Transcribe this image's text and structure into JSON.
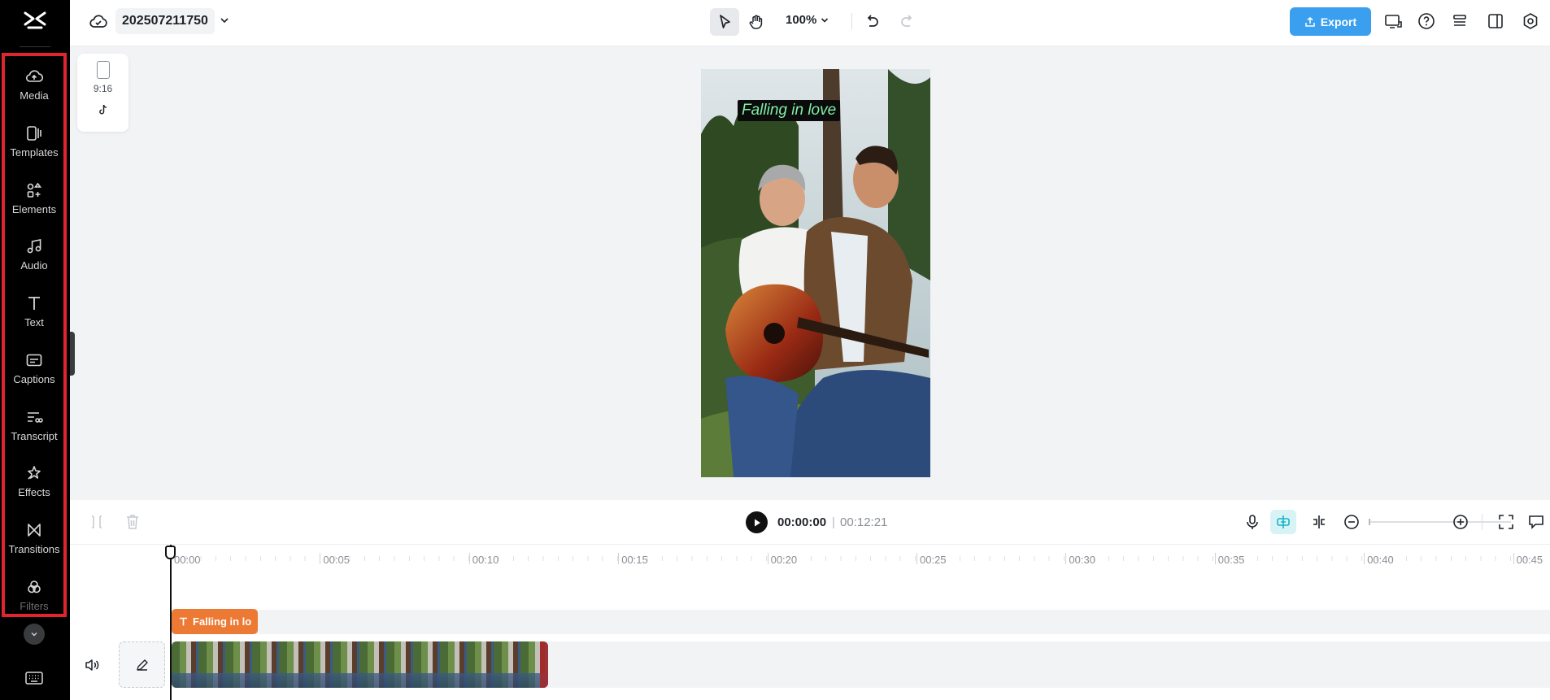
{
  "sidebar": {
    "items": [
      {
        "label": "Media",
        "icon": "media-cloud-icon"
      },
      {
        "label": "Templates",
        "icon": "templates-icon"
      },
      {
        "label": "Elements",
        "icon": "elements-icon"
      },
      {
        "label": "Audio",
        "icon": "audio-note-icon"
      },
      {
        "label": "Text",
        "icon": "text-t-icon"
      },
      {
        "label": "Captions",
        "icon": "captions-icon"
      },
      {
        "label": "Transcript",
        "icon": "transcript-icon"
      },
      {
        "label": "Effects",
        "icon": "effects-star-icon"
      },
      {
        "label": "Transitions",
        "icon": "transitions-icon"
      },
      {
        "label": "Filters",
        "icon": "filters-icon"
      }
    ]
  },
  "topbar": {
    "project_name": "202507211750",
    "zoom": "100%",
    "export_label": "Export"
  },
  "canvas": {
    "aspect_ratio": "9:16",
    "caption_text": "Falling in love"
  },
  "playback": {
    "current_time": "00:00:00",
    "separator": "|",
    "total_time": "00:12:21"
  },
  "timeline": {
    "ticks": [
      "00:00",
      "00:05",
      "00:10",
      "00:15",
      "00:20",
      "00:25",
      "00:30",
      "00:35",
      "00:40",
      "00:45"
    ],
    "text_clip_label": "Falling in lo"
  },
  "colors": {
    "accent": "#3b9ff0",
    "sidebar_highlight": "#e0252f",
    "text_clip": "#ec7a35",
    "caption_text": "#7ef0a6"
  }
}
